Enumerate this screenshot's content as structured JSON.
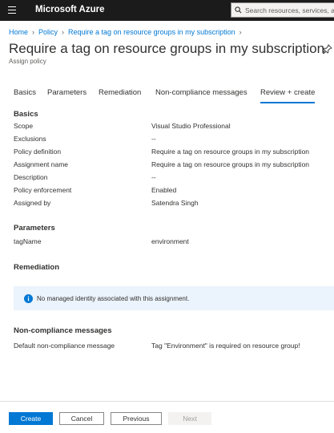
{
  "topbar": {
    "brand": "Microsoft Azure",
    "search_placeholder": "Search resources, services, and docs (G+/)",
    "icons": [
      "hamburger-menu-icon",
      "search-icon"
    ]
  },
  "breadcrumb": {
    "items": [
      "Home",
      "Policy",
      "Require a tag on resource groups in my subscription"
    ]
  },
  "header": {
    "title": "Require a tag on resource groups in my subscription",
    "subtitle": "Assign policy",
    "pin_icon": "pin-icon"
  },
  "tabs": [
    {
      "label": "Basics"
    },
    {
      "label": "Parameters"
    },
    {
      "label": "Remediation"
    },
    {
      "label": "Non-compliance messages"
    },
    {
      "label": "Review + create"
    }
  ],
  "active_tab": "Review + create",
  "basics": {
    "title": "Basics",
    "rows": [
      {
        "label": "Scope",
        "value": "Visual Studio Professional"
      },
      {
        "label": "Exclusions",
        "value": "--"
      },
      {
        "label": "Policy definition",
        "value": "Require a tag on resource groups in my subscription"
      },
      {
        "label": "Assignment name",
        "value": "Require a tag on resource groups in my subscription"
      },
      {
        "label": "Description",
        "value": "--"
      },
      {
        "label": "Policy enforcement",
        "value": "Enabled"
      },
      {
        "label": "Assigned by",
        "value": "Satendra Singh"
      }
    ]
  },
  "parameters": {
    "title": "Parameters",
    "rows": [
      {
        "label": "tagName",
        "value": "environment"
      }
    ]
  },
  "remediation": {
    "title": "Remediation",
    "info_text": "No managed identity associated with this assignment.",
    "info_icon": "info-icon"
  },
  "noncompliance": {
    "title": "Non-compliance messages",
    "rows": [
      {
        "label": "Default non-compliance message",
        "value": "Tag \"Environment\" is required on resource group!"
      }
    ]
  },
  "footer": {
    "create": "Create",
    "cancel": "Cancel",
    "previous": "Previous",
    "next": "Next"
  },
  "colors": {
    "topbar": "#1b1b1b",
    "accent": "#0078d4",
    "info_background": "#ebf3fc"
  }
}
